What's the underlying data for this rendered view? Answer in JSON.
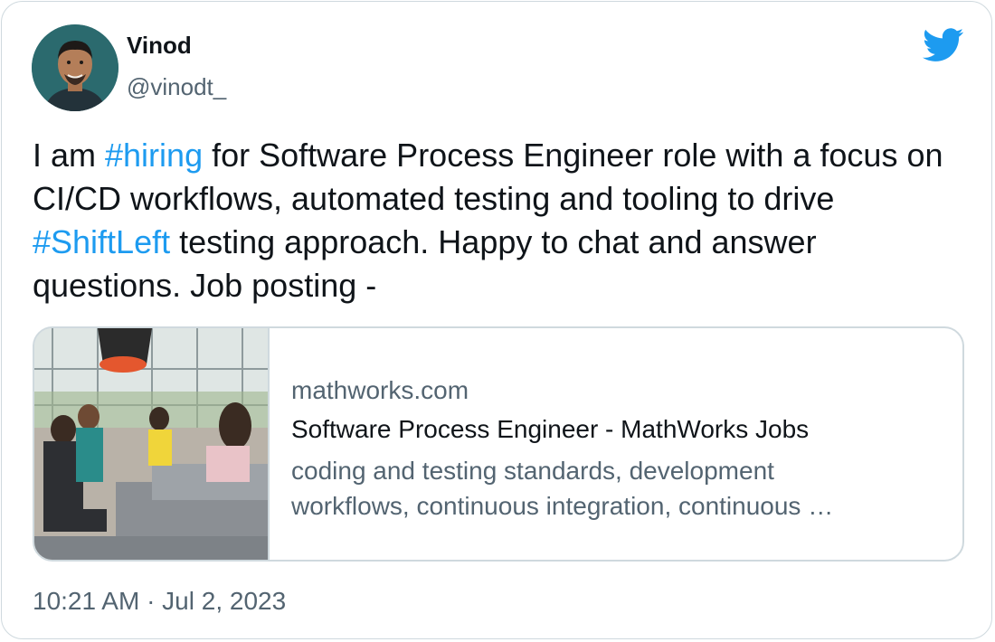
{
  "author": {
    "name": "Vinod",
    "handle": "@vinodt_"
  },
  "tweet": {
    "parts": [
      {
        "text": "I am ",
        "kind": "text"
      },
      {
        "text": "#hiring",
        "kind": "hashtag"
      },
      {
        "text": " for Software Process Engineer role with a focus on CI/CD workflows, automated testing and tooling to drive ",
        "kind": "text"
      },
      {
        "text": "#ShiftLeft",
        "kind": "hashtag"
      },
      {
        "text": " testing approach. Happy to chat and answer questions. Job posting -",
        "kind": "text"
      }
    ]
  },
  "link_card": {
    "domain": "mathworks.com",
    "title": "Software Process Engineer - MathWorks Jobs",
    "description": "coding and testing standards, development workflows, continuous integration, continuous …"
  },
  "timestamp": "10:21 AM · Jul 2, 2023",
  "icons": {
    "brand": "twitter-bird-icon",
    "avatar": "profile-photo",
    "thumbnail": "office-lounge-photo"
  },
  "colors": {
    "hashtag": "#1d9bf0",
    "text": "#0f1419",
    "secondary": "#536471",
    "border": "#cfd9de",
    "brand": "#1d9bf0"
  }
}
